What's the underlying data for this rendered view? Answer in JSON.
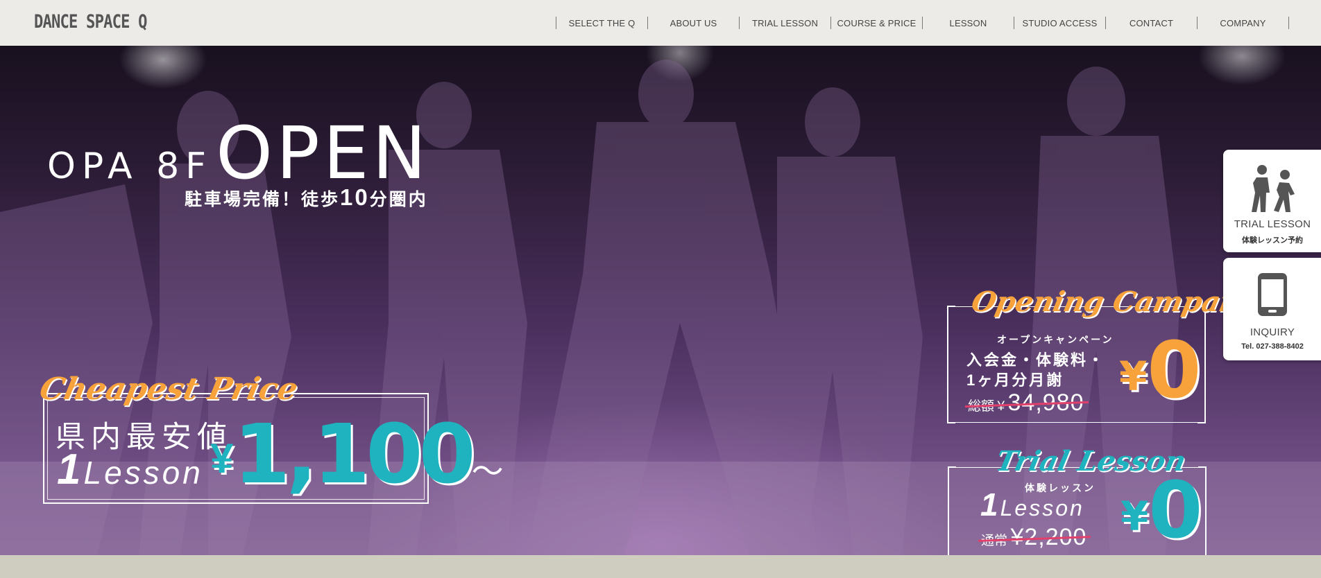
{
  "header": {
    "logo": "DANCE SPACE Q",
    "nav": [
      {
        "label": "SELECT THE Q"
      },
      {
        "label": "ABOUT US"
      },
      {
        "label": "TRIAL LESSON"
      },
      {
        "label": "COURSE & PRICE"
      },
      {
        "label": "LESSON"
      },
      {
        "label": "STUDIO ACCESS"
      },
      {
        "label": "CONTACT"
      },
      {
        "label": "COMPANY"
      }
    ]
  },
  "hero": {
    "open_prefix": "OPA 8F",
    "open_word": "OPEN",
    "parking_pre": "駐車場完備！徒歩",
    "parking_num": "10",
    "parking_post": "分圏内",
    "cheapest": {
      "script": "Cheapest Price",
      "jp": "県内最安値",
      "one": "1",
      "lesson": "Lesson",
      "yen": "¥",
      "price": "1,100",
      "tilde": "〜"
    },
    "campaign": {
      "script": "Opening Campaign",
      "kana": "オープンキャンペーン",
      "line1": "入会金・体験料・",
      "line2": "1ヶ月分月謝",
      "total_label": "総額",
      "yen_small": "¥",
      "old_price": "34,980",
      "yen": "¥",
      "new_price": "0"
    },
    "trial": {
      "script": "Trial Lesson",
      "kana": "体験レッスン",
      "one": "1",
      "lesson": "Lesson",
      "regular_label": "通常",
      "old_price": "¥2,200",
      "yen": "¥",
      "new_price": "0"
    }
  },
  "side": {
    "trial_title": "TRIAL LESSON",
    "trial_sub": "体験レッスン予約",
    "inquiry_title": "INQUIRY",
    "inquiry_sub": "Tel. 027-388-8402"
  },
  "colors": {
    "accent_orange": "#f7a23b",
    "accent_teal": "#1fb3bf",
    "strike_red": "#e0406a",
    "header_bg": "#ecebe7"
  },
  "icons": {
    "trial": "walking-people-icon",
    "inquiry": "smartphone-icon"
  }
}
